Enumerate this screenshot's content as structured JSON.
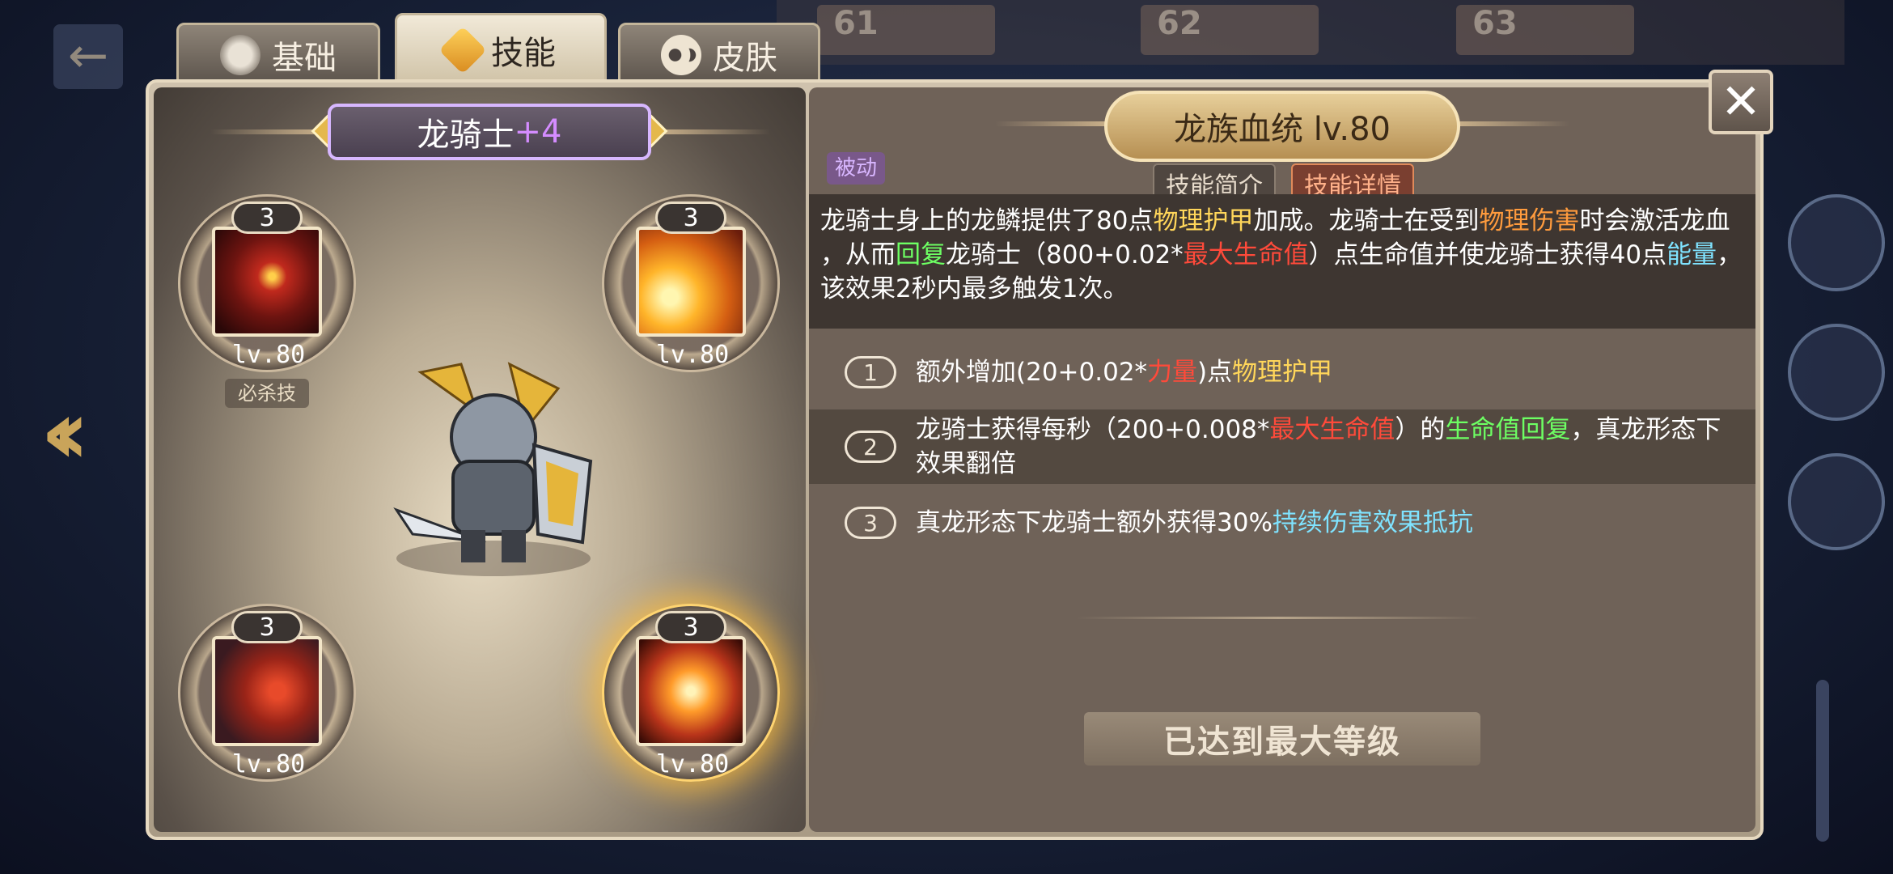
{
  "tabs": [
    {
      "label": "基础",
      "icon": "helmet-icon"
    },
    {
      "label": "技能",
      "icon": "skill-emblem-icon"
    },
    {
      "label": "皮肤",
      "icon": "mask-icon"
    }
  ],
  "background": {
    "stage_numbers": [
      "61",
      "62",
      "63"
    ]
  },
  "hero": {
    "name": "龙骑士",
    "plus": "+4"
  },
  "skills": [
    {
      "level_badge": "3",
      "level": "lv.80",
      "tag": "必杀技"
    },
    {
      "level_badge": "3",
      "level": "lv.80"
    },
    {
      "level_badge": "3",
      "level": "lv.80"
    },
    {
      "level_badge": "3",
      "level": "lv.80"
    }
  ],
  "detail": {
    "title": "龙族血统 lv.80",
    "type": "被动",
    "tab_intro": "技能简介",
    "tab_detail": "技能详情",
    "desc": {
      "l1a": "龙骑士身上的龙鳞提供了80点",
      "l1b": "物理护甲",
      "l1c": "加成。龙骑士在受到",
      "l1d": "物理伤害",
      "l1e": "时会激活龙血",
      "l2a": "，从而",
      "l2b": "回复",
      "l2c": "龙骑士（800+0.02*",
      "l2d": "最大生命值",
      "l2e": "）点生命值并使龙骑士获得40点",
      "l2f": "能量",
      "l2g": "，",
      "l3": "该效果2秒内最多触发1次。"
    },
    "upgrades": [
      {
        "num": "1",
        "a": "额外增加(20+0.02*",
        "b": "力量",
        "c": ")点",
        "d": "物理护甲"
      },
      {
        "num": "2",
        "a": "龙骑士获得每秒（200+0.008*",
        "b": "最大生命值",
        "c": "）的",
        "d": "生命值回复",
        "e": "，真龙形态下",
        "f": "效果翻倍"
      },
      {
        "num": "3",
        "a": "真龙形态下龙骑士额外获得30%",
        "b": "持续伤害效果抵抗"
      }
    ],
    "max_level": "已达到最大等级"
  },
  "colors": {
    "accent_gold": "#e4b84c",
    "highlight_purple": "#d7b7ff",
    "keyword_yellow": "#ffd65a",
    "keyword_red": "#ff4a3a",
    "keyword_green": "#6dff63",
    "keyword_cyan": "#7fe3ff"
  }
}
